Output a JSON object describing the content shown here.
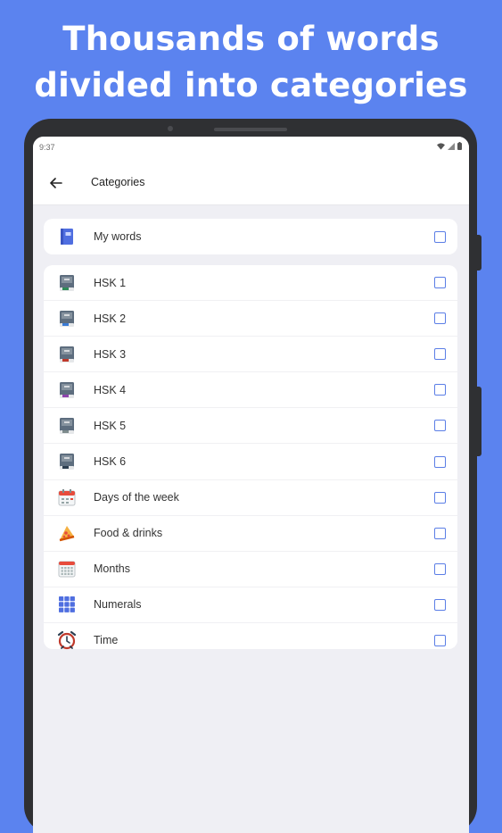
{
  "headline": {
    "line1": "Thousands of words",
    "line2": "divided into categories"
  },
  "statusbar": {
    "time": "9:37",
    "icons": [
      "wifi-icon",
      "signal-icon",
      "battery-icon"
    ]
  },
  "appbar": {
    "back_icon": "arrow-left-icon",
    "title": "Categories"
  },
  "my_words": {
    "label": "My words",
    "icon": "notebook-icon",
    "checked": false
  },
  "categories": [
    {
      "label": "HSK 1",
      "icon": "book-icon",
      "checked": false
    },
    {
      "label": "HSK 2",
      "icon": "book-icon",
      "checked": false
    },
    {
      "label": "HSK 3",
      "icon": "book-icon",
      "checked": false
    },
    {
      "label": "HSK 4",
      "icon": "book-icon",
      "checked": false
    },
    {
      "label": "HSK 5",
      "icon": "book-icon",
      "checked": false
    },
    {
      "label": "HSK 6",
      "icon": "book-icon",
      "checked": false
    },
    {
      "label": "Days of the week",
      "icon": "calendar-icon",
      "checked": false
    },
    {
      "label": "Food & drinks",
      "icon": "pizza-icon",
      "checked": false
    },
    {
      "label": "Months",
      "icon": "calendar-grid-icon",
      "checked": false
    },
    {
      "label": "Numerals",
      "icon": "numbers-grid-icon",
      "checked": false
    },
    {
      "label": "Time",
      "icon": "alarm-clock-icon",
      "checked": false
    }
  ],
  "colors": {
    "background": "#5b83ef",
    "accent": "#5b7ee6",
    "device": "#2f3033",
    "screen_bg": "#efeff4"
  }
}
